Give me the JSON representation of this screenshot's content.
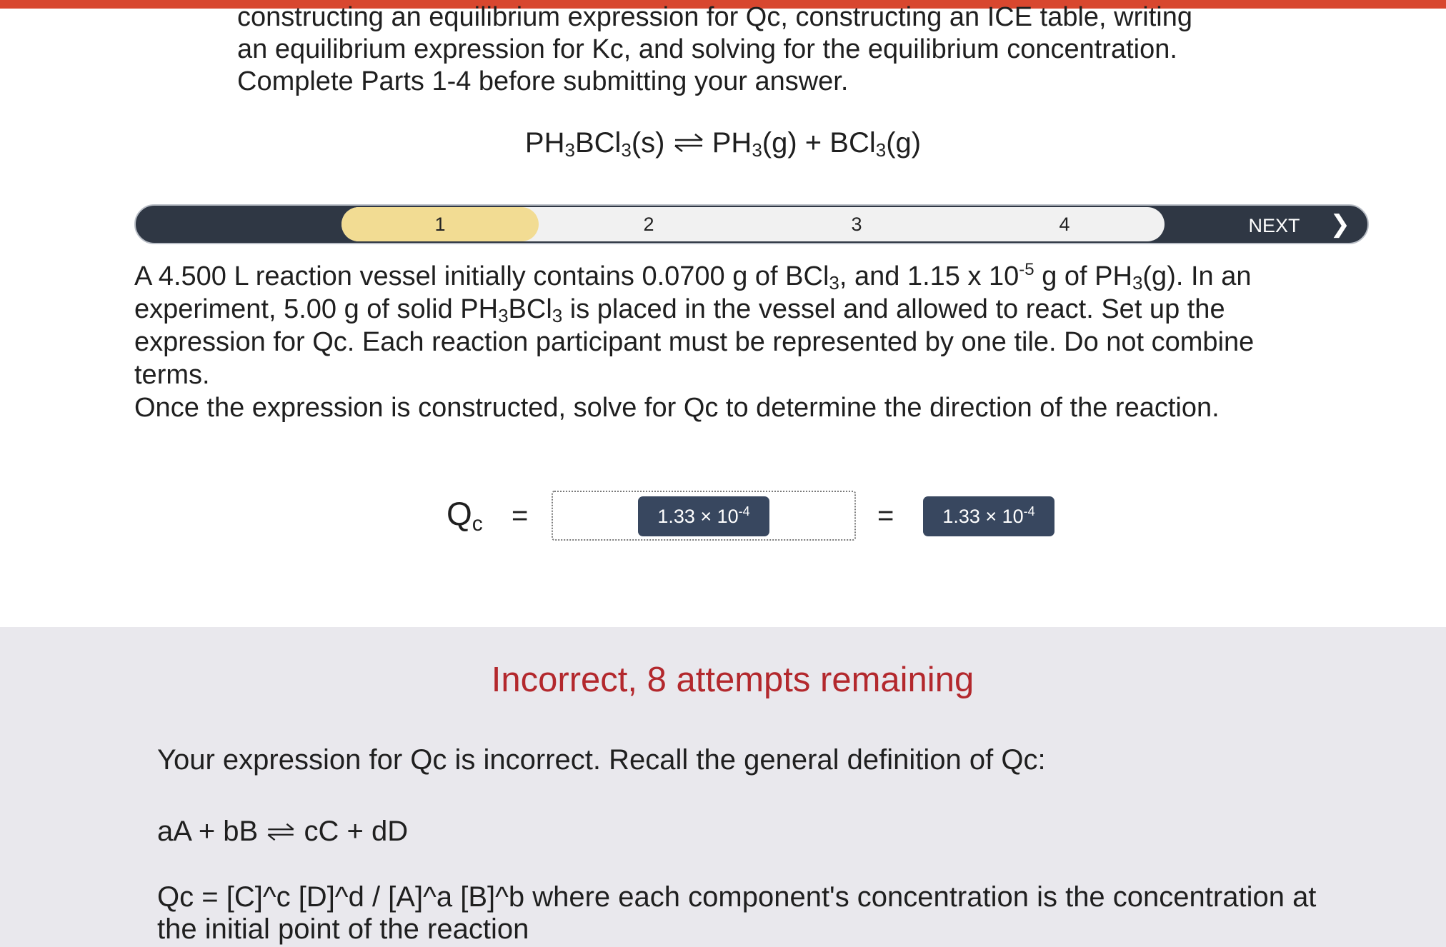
{
  "intro": {
    "lines": [
      "constructing an equilibrium expression for Qc, constructing an ICE table, writing",
      "an equilibrium expression for Kc, and solving for the equilibrium concentration.",
      "Complete Parts 1-4 before submitting your answer."
    ]
  },
  "reaction": {
    "reactant": "PH",
    "reactant_sub1": "3",
    "reactant_mid": "BCl",
    "reactant_sub2": "3",
    "reactant_state": "(s)",
    "product1": "PH",
    "product1_sub": "3",
    "product1_state": "(g) + BCl",
    "product2_sub": "3",
    "product2_state": "(g)"
  },
  "stepper": {
    "steps": [
      "1",
      "2",
      "3",
      "4"
    ],
    "active_step": "1",
    "next_label": "NEXT",
    "next_icon": "chevron-right-icon",
    "colors": {
      "bar": "#2f3744",
      "active": "#f2dc93",
      "track": "#f1f1f1"
    }
  },
  "question": {
    "p1_a": "A 4.500 L reaction vessel initially contains 0.0700 g of BCl",
    "p1_a_sub": "3",
    "p1_b": ", and 1.15 x 10",
    "p1_b_sup": "-5",
    "p1_c": " g of PH",
    "p1_c_sub": "3",
    "p1_d": "(g). In an",
    "p2_a": "experiment, 5.00 g of solid PH",
    "p2_a_sub": "3",
    "p2_b": "BCl",
    "p2_b_sub": "3",
    "p2_c": " is placed in the vessel and allowed to react. Set up the",
    "p3": "expression for Qc. Each reaction participant must be represented by one tile. Do not combine",
    "p4": "terms.",
    "p5": "Once the expression is constructed, solve for Qc to determine the direction of the reaction."
  },
  "expression": {
    "label": "Q",
    "label_sub": "c",
    "equals": "=",
    "tile_base": "1.33 × 10",
    "tile_exp": "-4",
    "result_base": "1.33 × 10",
    "result_exp": "-4"
  },
  "feedback": {
    "status": "Incorrect, 8 attempts remaining",
    "status_color": "#b3282d",
    "message": "Your expression for Qc is incorrect. Recall the general definition of Qc:",
    "general_left": "aA + bB",
    "general_right": "cC + dD",
    "definition": [
      "Qc = [C]^c [D]^d / [A]^a [B]^b where each component's concentration is the concentration at",
      "the initial point of the reaction"
    ]
  }
}
